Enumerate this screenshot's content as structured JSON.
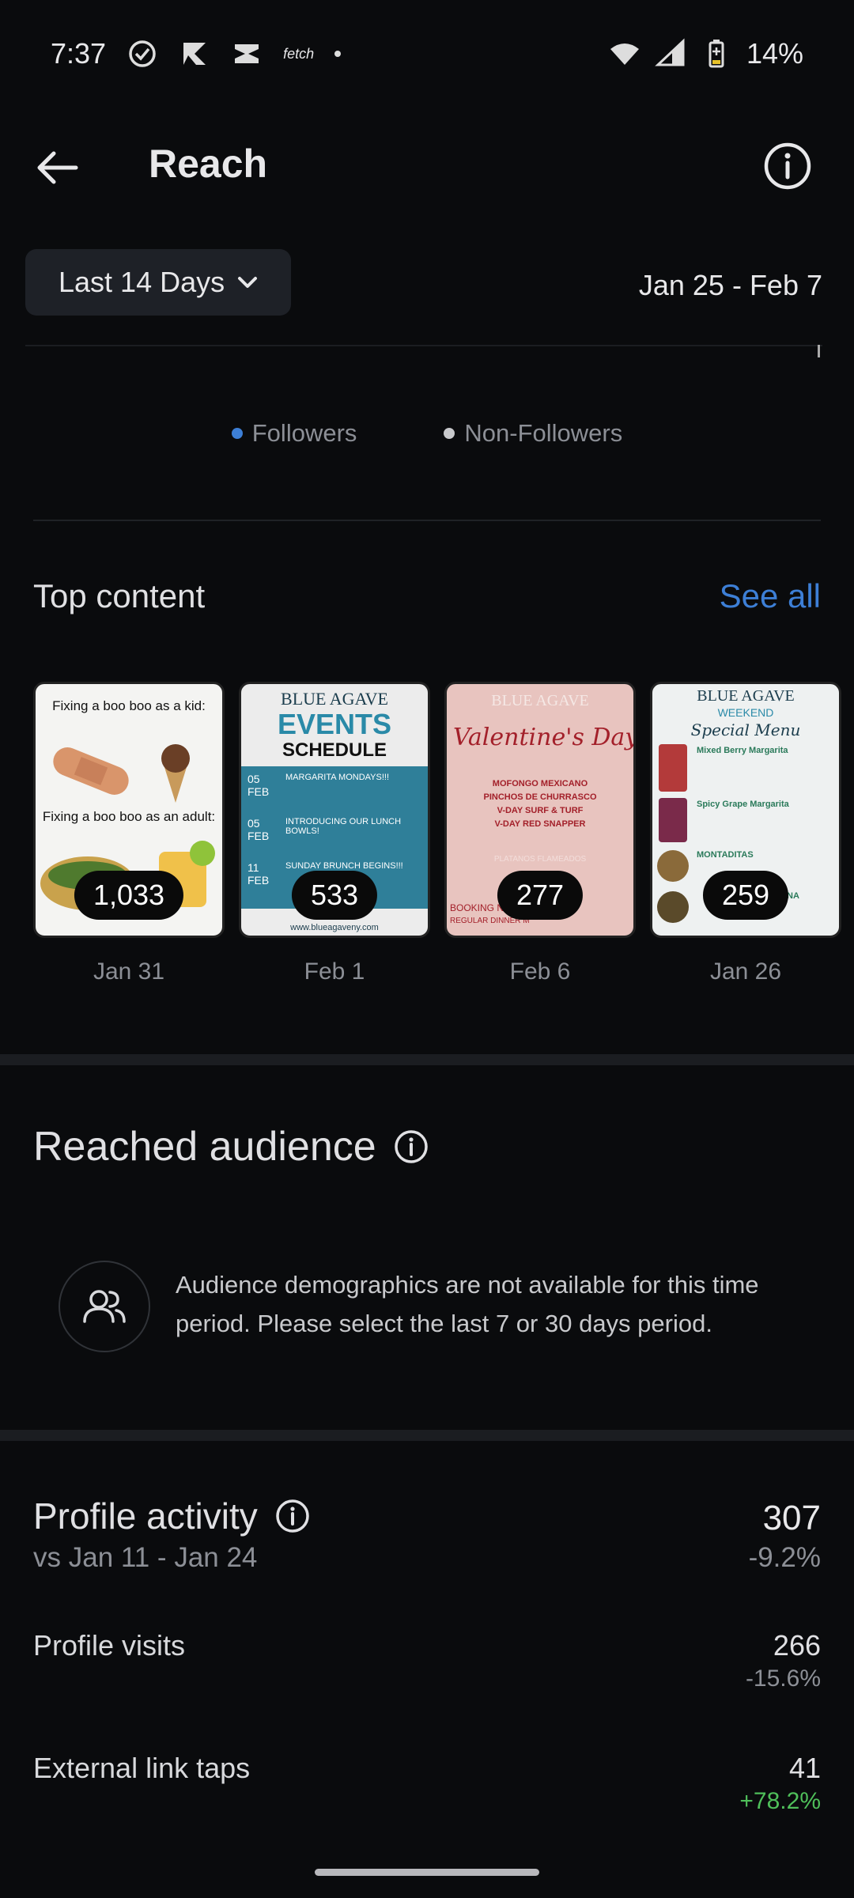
{
  "status": {
    "time": "7:37",
    "fetch_label": "fetch",
    "battery": "14%"
  },
  "header": {
    "title": "Reach"
  },
  "filter": {
    "range_label": "Last 14 Days",
    "date_range": "Jan 25 - Feb 7"
  },
  "legend": {
    "followers": "Followers",
    "non_followers": "Non-Followers",
    "followers_color": "#3d7fd6",
    "non_followers_color": "#c8c9cc"
  },
  "top_content": {
    "title": "Top content",
    "see_all": "See all",
    "items": [
      {
        "count": "1,033",
        "date": "Jan 31",
        "line1": "Fixing a boo boo as a kid:",
        "line2": "Fixing a boo boo as an adult:"
      },
      {
        "count": "533",
        "date": "Feb 1",
        "brand": "BLUE AGAVE",
        "heading1": "EVENTS",
        "heading2": "SCHEDULE",
        "rows": [
          {
            "d1": "05",
            "d2": "FEB",
            "t": "MARGARITA MONDAYS!!!"
          },
          {
            "d1": "05",
            "d2": "FEB",
            "t": "INTRODUCING OUR LUNCH BOWLS!"
          },
          {
            "d1": "11",
            "d2": "FEB",
            "t": "SUNDAY BRUNCH BEGINS!!!"
          }
        ],
        "url": "www.blueagaveny.com"
      },
      {
        "count": "277",
        "date": "Feb 6",
        "brand": "BLUE AGAVE",
        "script": "Valentine's Day Me",
        "menu": [
          "MOFONGO MEXICANO",
          "PINCHOS DE CHURRASCO",
          "V-DAY SURF & TURF",
          "V-DAY RED SNAPPER"
        ],
        "extra": "PLATANOS FLAMEADOS",
        "footer1": "BOOKING NO",
        "footer2": "REGULAR DINNER M"
      },
      {
        "count": "259",
        "date": "Jan 26",
        "brand": "BLUE AGAVE",
        "sub": "WEEKEND",
        "script": "Special Menu",
        "items": [
          "Mixed Berry Margarita",
          "Spicy Grape Margarita",
          "MONTADITAS",
          "NA"
        ]
      }
    ]
  },
  "audience": {
    "title": "Reached audience",
    "message": "Audience demographics are not available for this time period. Please select the last 7 or 30 days period."
  },
  "profile_activity": {
    "title": "Profile activity",
    "value": "307",
    "compare": "vs Jan 11 - Jan 24",
    "change": "-9.2%",
    "rows": [
      {
        "label": "Profile visits",
        "value": "266",
        "change": "-15.6%",
        "change_color": "#8c8f96"
      },
      {
        "label": "External link taps",
        "value": "41",
        "change": "+78.2%",
        "change_color": "#4fbf5a"
      }
    ]
  }
}
